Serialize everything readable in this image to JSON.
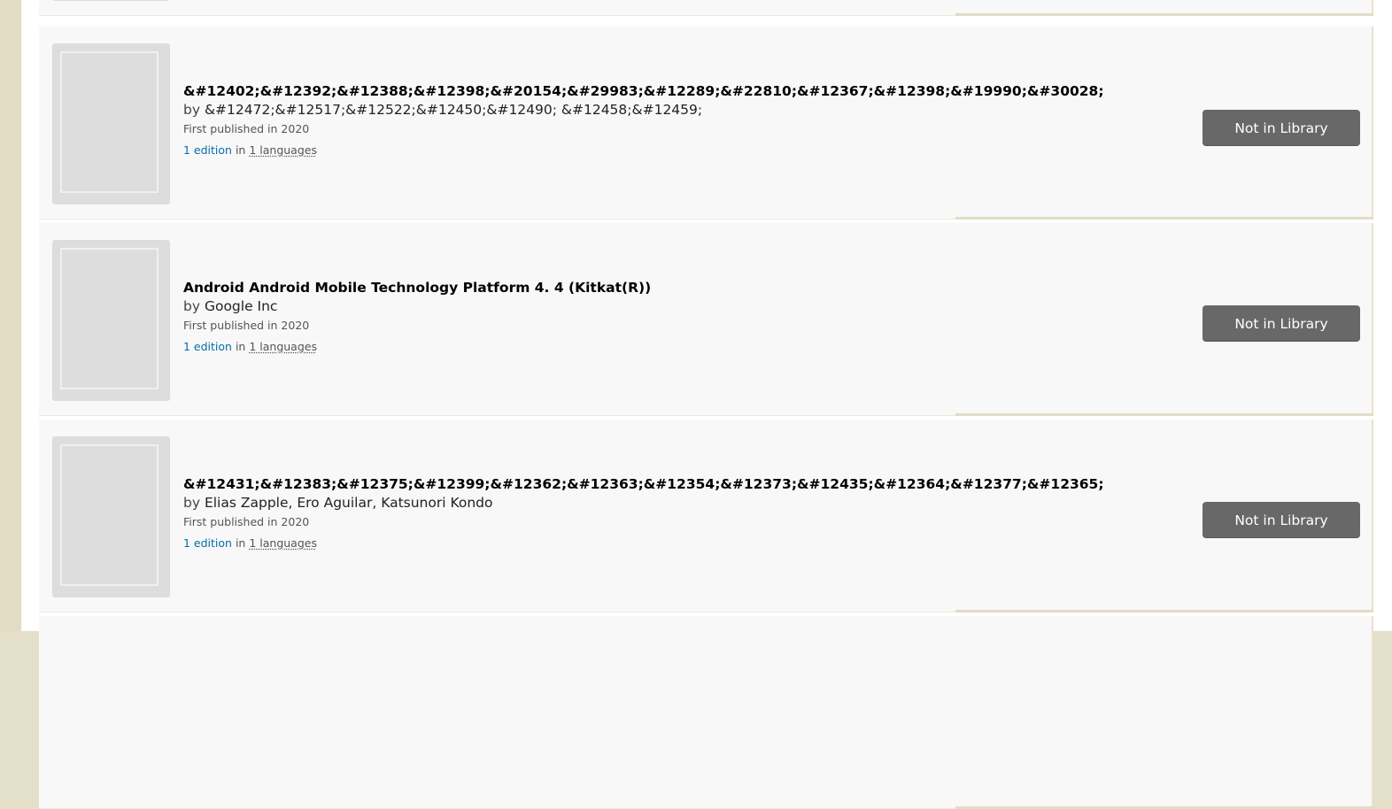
{
  "results": [
    {
      "title": "&#12402;&#12392;&#12388;&#12398;&#20154;&#29983;&#12289;&#22810;&#12367;&#12398;&#19990;&#30028;",
      "by_prefix": "by",
      "authors": "&#12472;&#12517;&#12522;&#12450;&#12490; &#12458;&#12459;",
      "first_published": "First published in 2020",
      "editions_label": "1 edition",
      "in_word": "in",
      "languages_label": "1 languages",
      "button_label": "Not in Library"
    },
    {
      "title": "Android Android Mobile Technology Platform 4. 4 (Kitkat(R))",
      "by_prefix": "by",
      "authors": "Google Inc",
      "first_published": "First published in 2020",
      "editions_label": "1 edition",
      "in_word": "in",
      "languages_label": "1 languages",
      "button_label": "Not in Library"
    },
    {
      "title": "&#12431;&#12383;&#12375;&#12399;&#12362;&#12363;&#12354;&#12373;&#12435;&#12364;&#12377;&#12365;",
      "by_prefix": "by",
      "authors": "Elias Zapple, Ero Aguilar, Katsunori Kondo",
      "first_published": "First published in 2020",
      "editions_label": "1 edition",
      "in_word": "in",
      "languages_label": "1 languages",
      "button_label": "Not in Library"
    }
  ],
  "colors": {
    "page_background": "#e4dfc8",
    "card_background": "#f8f8f8",
    "button_background": "#686868",
    "link_color": "#036daa"
  },
  "icons": {
    "cover_placeholder": "book-cover-placeholder-icon"
  }
}
